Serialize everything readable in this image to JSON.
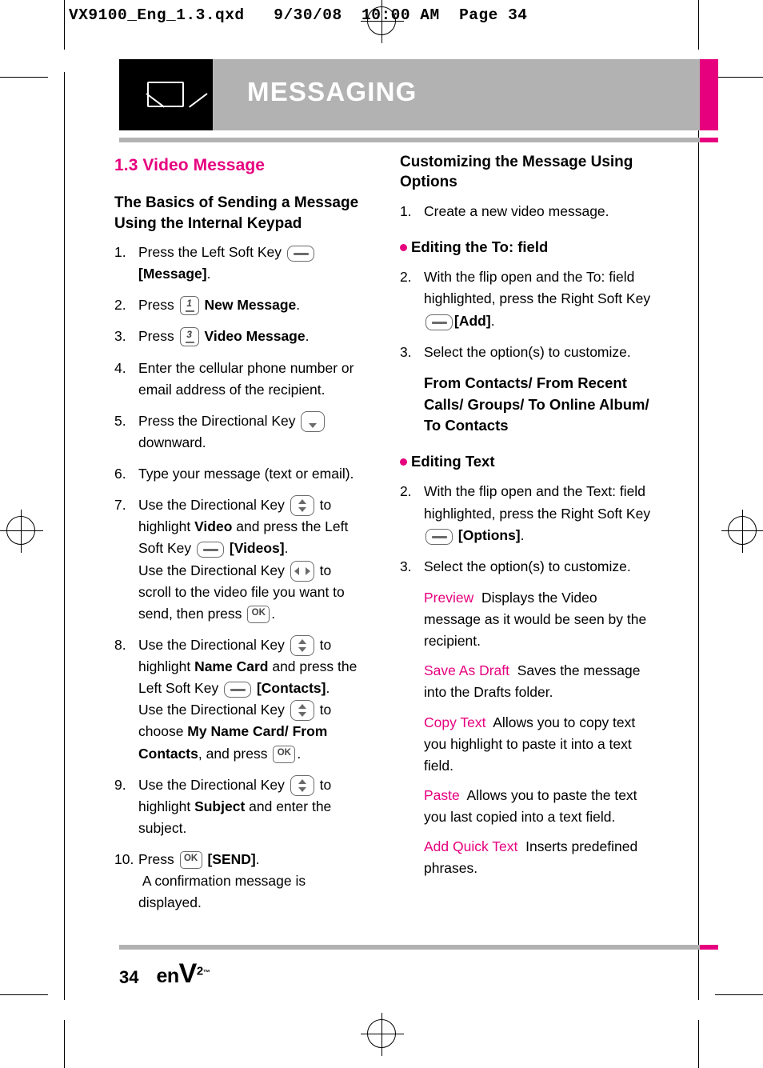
{
  "file_info": "VX9100_Eng_1.3.qxd   9/30/08  10:00 AM  Page 34",
  "banner": {
    "title": "MESSAGING",
    "icon": "envelope-icon"
  },
  "left_column": {
    "section_title": "1.3 Video Message",
    "sub_title": "The Basics of Sending a Message Using the Internal Keypad",
    "steps": [
      {
        "num": "1.",
        "html": "Press the Left Soft Key <span class=\"key key-soft\" data-name=\"left-soft-key-icon\" data-interactable=\"false\"></span> <b>[Message]</b>."
      },
      {
        "num": "2.",
        "html": "Press <span class=\"key key-num\" data-name=\"number-key-1-icon\" data-interactable=\"false\"><span>1</span></span> <b>New Message</b>."
      },
      {
        "num": "3.",
        "html": "Press <span class=\"key key-num\" data-name=\"number-key-3-icon\" data-interactable=\"false\"><span>3</span></span> <b>Video Message</b>."
      },
      {
        "num": "4.",
        "html": "Enter the cellular phone number or email address of the recipient."
      },
      {
        "num": "5.",
        "html": "Press the Directional Key <span class=\"key key-dir\" data-name=\"directional-key-down-icon\" data-interactable=\"false\"><i class=\"ar dn\"></i></span> downward."
      },
      {
        "num": "6.",
        "html": "Type your message (text or email)."
      },
      {
        "num": "7.",
        "html": "Use the Directional Key <span class=\"key key-dir\" data-name=\"directional-key-updown-icon\" data-interactable=\"false\"><i class=\"ar up\"></i><i class=\"ar dn\"></i></span> to highlight <b>Video</b> and press the Left Soft Key <span class=\"key key-soft\" data-name=\"left-soft-key-icon\" data-interactable=\"false\"></span> <b>[Videos]</b>.<br>Use the Directional Key <span class=\"key key-dir\" data-name=\"directional-key-leftright-icon\" data-interactable=\"false\"><i class=\"arh lf\"></i><i class=\"arh rt\"></i></span> to scroll to the video file you want to send, then press <span class=\"key key-ok\" data-name=\"ok-key-icon\" data-interactable=\"false\"><span>OK</span></span>."
      },
      {
        "num": "8.",
        "html": "Use the Directional Key <span class=\"key key-dir\" data-name=\"directional-key-updown-icon\" data-interactable=\"false\"><i class=\"ar up\"></i><i class=\"ar dn\"></i></span> to highlight <b>Name Card</b> and press the Left Soft Key <span class=\"key key-soft\" data-name=\"left-soft-key-icon\" data-interactable=\"false\"></span> <b>[Contacts]</b>.<br>Use the Directional Key <span class=\"key key-dir\" data-name=\"directional-key-updown-icon\" data-interactable=\"false\"><i class=\"ar up\"></i><i class=\"ar dn\"></i></span> to choose <b>My Name Card/ From Contacts</b>, and press <span class=\"key key-ok\" data-name=\"ok-key-icon\" data-interactable=\"false\"><span>OK</span></span>."
      },
      {
        "num": "9.",
        "html": "Use the Directional Key <span class=\"key key-dir\" data-name=\"directional-key-updown-icon\" data-interactable=\"false\"><i class=\"ar up\"></i><i class=\"ar dn\"></i></span> to highlight <b>Subject</b> and enter the subject."
      },
      {
        "num": "10.",
        "html": "Press <span class=\"key key-ok\" data-name=\"ok-key-icon\" data-interactable=\"false\"><span>OK</span></span> <b>[SEND]</b>.<br>&nbsp;A confirmation message is displayed."
      }
    ]
  },
  "right_column": {
    "sub_title": "Customizing the Message Using Options",
    "intro_step": {
      "num": "1.",
      "html": "Create a new video message."
    },
    "bullets": [
      {
        "label": "Editing the To: field",
        "steps": [
          {
            "num": "2.",
            "html": "With the flip open and the To: field highlighted, press the Right Soft Key <span class=\"key key-soft\" data-name=\"right-soft-key-icon\" data-interactable=\"false\"></span><b>[Add]</b>."
          },
          {
            "num": "3.",
            "html": "Select the option(s) to customize."
          }
        ],
        "emphasis": "From Contacts/ From Recent Calls/ Groups/ To Online Album/ To Contacts",
        "options": []
      },
      {
        "label": "Editing Text",
        "steps": [
          {
            "num": "2.",
            "html": "With the flip open and the Text: field highlighted, press the Right Soft Key <span class=\"key key-soft\" data-name=\"right-soft-key-icon\" data-interactable=\"false\"></span> <b>[Options]</b>."
          },
          {
            "num": "3.",
            "html": "Select the option(s) to customize."
          }
        ],
        "emphasis": "",
        "options": [
          {
            "name": "Preview",
            "desc": "Displays the Video message as it would be seen by the recipient."
          },
          {
            "name": "Save As Draft",
            "desc": "Saves the message into the Drafts folder."
          },
          {
            "name": "Copy Text",
            "desc": "Allows you to copy text you highlight to paste it into a text field."
          },
          {
            "name": "Paste",
            "desc": "Allows you to paste the text you last copied into a text field."
          },
          {
            "name": "Add Quick Text",
            "desc": "Inserts predefined phrases."
          }
        ]
      }
    ]
  },
  "footer": {
    "page_number": "34",
    "logo_prefix": "en",
    "logo_v": "V",
    "logo_sup": "2",
    "logo_tm": "™"
  },
  "colors": {
    "accent_pink": "#e6007e",
    "banner_gray": "#b2b2b2",
    "banner_black": "#000000"
  }
}
